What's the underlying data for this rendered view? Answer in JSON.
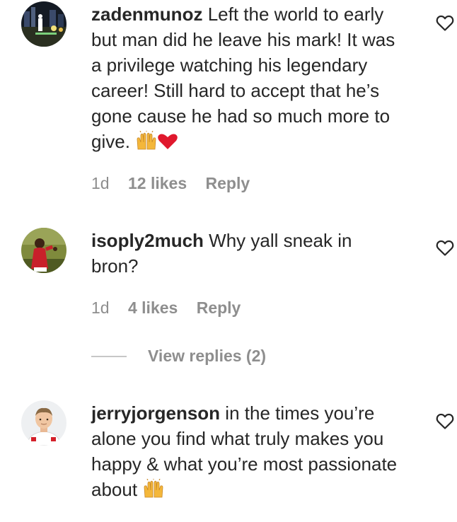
{
  "comments": [
    {
      "username": "zadenmunoz",
      "text": "Left the world to early but man did he leave his mark! It was a privilege watching his legendary career! Still hard to accept that he’s gone cause he had so much more to give.",
      "emoji": "🙌❤️",
      "time": "1d",
      "likes": "12 likes",
      "reply": "Reply",
      "avatar_icon": "avatar-city-night"
    },
    {
      "username": "isoply2much",
      "text": "Why yall sneak in bron?",
      "emoji": "",
      "time": "1d",
      "likes": "4 likes",
      "reply": "Reply",
      "avatar_icon": "avatar-basketball-player"
    },
    {
      "username": "jerryjorgenson",
      "text": "in the times you’re alone you find what truly makes you happy & what you’re most passionate about",
      "emoji": "🙌",
      "avatar_icon": "avatar-young-man"
    }
  ],
  "view_replies": {
    "label": "View replies (2)"
  },
  "colors": {
    "text": "#262626",
    "secondary": "#8e8e8e",
    "divider": "#c7c7c7",
    "heart_outline": "#262626",
    "emoji_heart": "#e0182d",
    "emoji_hands": "#f4b73a"
  }
}
